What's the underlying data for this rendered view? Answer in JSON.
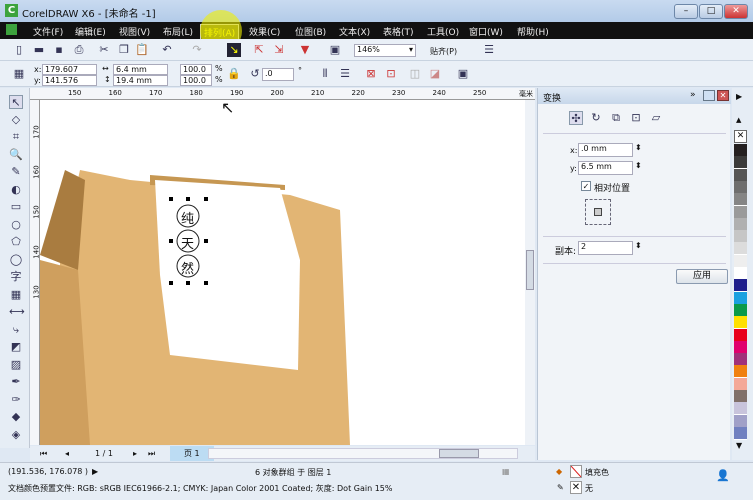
{
  "window": {
    "title": "CorelDRAW X6 - [未命名 -1]",
    "minimize": "–",
    "maximize": "□",
    "close": "✕"
  },
  "menu": [
    {
      "label": "文件(F)"
    },
    {
      "label": "编辑(E)"
    },
    {
      "label": "视图(V)"
    },
    {
      "label": "布局(L)"
    },
    {
      "label": "排列(A)",
      "active": true
    },
    {
      "label": "效果(C)"
    },
    {
      "label": "位图(B)"
    },
    {
      "label": "文本(X)"
    },
    {
      "label": "表格(T)"
    },
    {
      "label": "工具(O)"
    },
    {
      "label": "窗口(W)"
    },
    {
      "label": "帮助(H)"
    }
  ],
  "toolbar": {
    "zoom": "146%",
    "snap": "贴齐(P)"
  },
  "property_bar": {
    "x": "179.607 mm",
    "y": "141.576 mm",
    "x_label": "x:",
    "y_label": "y:",
    "width": "6.4 mm",
    "height": "19.4 mm",
    "scale_x": "100.0",
    "scale_y": "100.0",
    "pct": "%",
    "rotation": ".0",
    "deg": "°"
  },
  "ruler": {
    "ticks": [
      "150",
      "160",
      "170",
      "180",
      "190",
      "200",
      "210",
      "220",
      "230",
      "240",
      "250"
    ],
    "unit": "毫米",
    "vticks": [
      "170",
      "160",
      "150",
      "140",
      "130"
    ]
  },
  "canvas": {
    "chars": [
      "纯",
      "天",
      "然"
    ],
    "bag_color": "#e2b574"
  },
  "page_nav": {
    "current": "1 / 1",
    "tab": "页 1"
  },
  "docker": {
    "title": "变换",
    "x_label": "x:",
    "x_value": ".0 mm",
    "y_label": "y:",
    "y_value": "6.5 mm",
    "relative_label": "相对位置",
    "relative_checked": true,
    "copies_label": "副本:",
    "copies_value": "2",
    "apply": "应用"
  },
  "palette": [
    "#231f20",
    "#3a3a3a",
    "#555555",
    "#6e6e6e",
    "#858585",
    "#9a9a9a",
    "#b0b0b0",
    "#c6c6c6",
    "#dcdcdc",
    "#eeeeee",
    "#ffffff",
    "#1e1e8c",
    "#1aa0e0",
    "#0a9a4a",
    "#ffe000",
    "#e8001c",
    "#e0006e",
    "#a0307a",
    "#f08010",
    "#f4a898",
    "#80706a",
    "#c8c4dc",
    "#a0a0c8",
    "#7080c0"
  ],
  "status": {
    "coords": "(191.536, 176.078 )",
    "object_info": "6 对象群组 于 图层 1",
    "color_profile": "文档颜色预置文件: RGB: sRGB IEC61966-2.1; CMYK: Japan Color 2001 Coated; 灰度: Dot Gain 15%",
    "fill": "填充色",
    "outline": "无"
  }
}
